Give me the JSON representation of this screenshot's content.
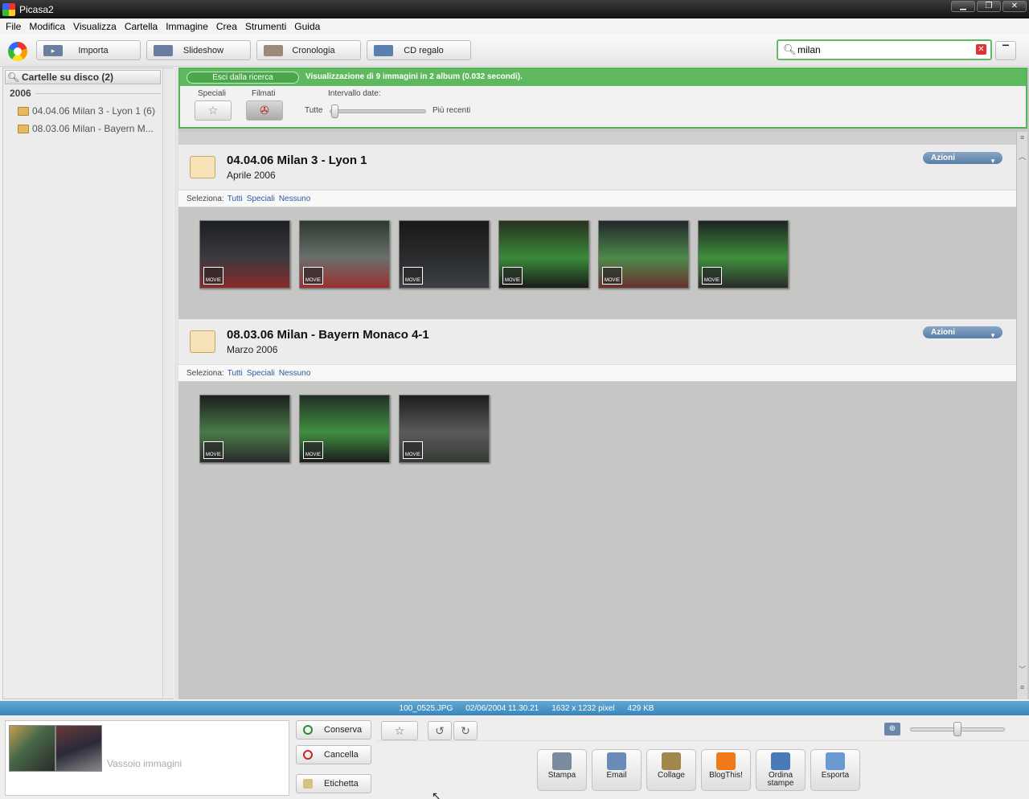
{
  "window": {
    "title": "Picasa2",
    "buttons": [
      "▁",
      "❐",
      "✕"
    ]
  },
  "menu": [
    "File",
    "Modifica",
    "Visualizza",
    "Cartella",
    "Immagine",
    "Crea",
    "Strumenti",
    "Guida"
  ],
  "toolbar": {
    "import_label": "Importa",
    "slideshow_label": "Slideshow",
    "timeline_label": "Cronologia",
    "gift_cd_label": "CD regalo"
  },
  "search": {
    "value": "milan",
    "clear": "✕"
  },
  "sidebar": {
    "title": "Cartelle su disco (2)",
    "year": "2006",
    "folders": [
      {
        "label": "04.04.06 Milan 3 - Lyon 1 (6)"
      },
      {
        "label": "08.03.06 Milan - Bayern M..."
      }
    ]
  },
  "results": {
    "exit_label": "Esci dalla ricerca",
    "summary": "Visualizzazione di 9 immagini in 2 album (0.032 secondi).",
    "filters": {
      "starred_label": "Speciali",
      "movies_label": "Filmati",
      "date_range_label": "Intervallo date:",
      "date_min_label": "Tutte",
      "date_max_label": "Più recenti",
      "date_range_value": 0.0
    }
  },
  "albums": [
    {
      "title": "04.04.06 Milan 3 - Lyon 1",
      "date": "Aprile 2006",
      "actions_label": "Azioni",
      "thumbs": [
        {
          "badge": "MOVIE",
          "colors": [
            "#1c1f24",
            "#3b3a3f",
            "#8a2a2a"
          ]
        },
        {
          "badge": "MOVIE",
          "colors": [
            "#2c3a30",
            "#6a6f6c",
            "#9a3030"
          ]
        },
        {
          "badge": "MOVIE",
          "colors": [
            "#16181a",
            "#2a2c2e",
            "#3d4045"
          ]
        },
        {
          "badge": "MOVIE",
          "colors": [
            "#28301f",
            "#3a8a3a",
            "#1a1a1a"
          ]
        },
        {
          "badge": "MOVIE",
          "colors": [
            "#22262a",
            "#4c8a4a",
            "#6a3030"
          ]
        },
        {
          "badge": "MOVIE",
          "colors": [
            "#1e2224",
            "#3f8f3c",
            "#2a2a2a"
          ]
        }
      ]
    },
    {
      "title": "08.03.06 Milan - Bayern Monaco 4-1",
      "date": "Marzo 2006",
      "actions_label": "Azioni",
      "thumbs": [
        {
          "badge": "MOVIE",
          "colors": [
            "#1a1f1c",
            "#4a7a4a",
            "#2a2a2a"
          ]
        },
        {
          "badge": "MOVIE",
          "colors": [
            "#223024",
            "#3f8f3f",
            "#1c1c1c"
          ]
        },
        {
          "badge": "MOVIE",
          "colors": [
            "#1b1d1e",
            "#5a5a5a",
            "#353a35"
          ]
        }
      ]
    }
  ],
  "select_row": {
    "label": "Seleziona:",
    "all": "Tutti",
    "starred": "Speciali",
    "none": "Nessuno"
  },
  "info": {
    "filename": "100_0525.JPG",
    "datetime": "02/06/2004 11.30.21",
    "dimensions": "1632 x 1232 pixel",
    "size": "429 KB"
  },
  "tray": {
    "label": "Vassoio immagini",
    "keep_label": "Conserva",
    "clear_label": "Cancella",
    "tag_label": "Etichetta"
  },
  "zoom": {
    "value": 0.5
  },
  "actions": [
    {
      "label": "Stampa",
      "icon": "printer-icon",
      "color": "#7c8aa0"
    },
    {
      "label": "Email",
      "icon": "email-icon",
      "color": "#6a8ab8"
    },
    {
      "label": "Collage",
      "icon": "collage-icon",
      "color": "#a0884c"
    },
    {
      "label": "BlogThis!",
      "icon": "blogger-icon",
      "color": "#f07a18"
    },
    {
      "label": "Ordina stampe",
      "icon": "globe-icon",
      "color": "#4a7ab8"
    },
    {
      "label": "Esporta",
      "icon": "export-icon",
      "color": "#6a9ad0"
    }
  ],
  "colors": {
    "accent_green": "#5eb95e",
    "info_blue": "#3b85b9"
  }
}
